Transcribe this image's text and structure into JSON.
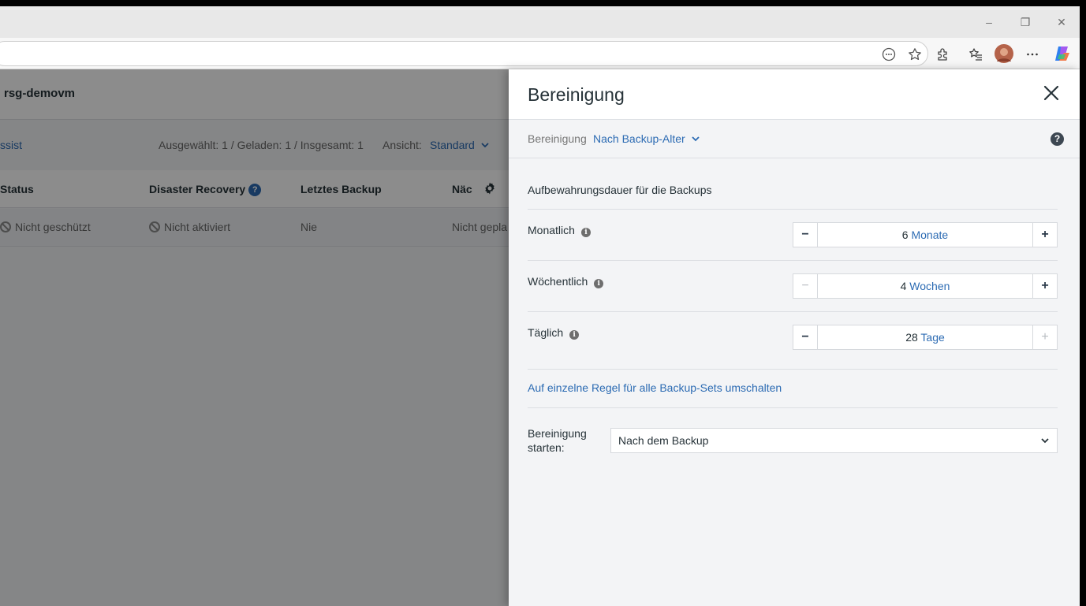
{
  "browser": {
    "controls": {
      "minimize": "–",
      "restore": "❐",
      "close": "✕"
    },
    "toolbar_icons": [
      "reader-icon",
      "favorite-star-icon",
      "extensions-icon",
      "favorites-icon",
      "profile-avatar",
      "more-icon",
      "copilot-icon"
    ]
  },
  "page": {
    "title": "rsg-demovm",
    "assist_link": "ssist",
    "selection_info": "Ausgewählt: 1 / Geladen: 1 / Insgesamt: 1",
    "view_label": "Ansicht:",
    "view_value": "Standard",
    "table": {
      "headers": [
        "Status",
        "Disaster Recovery",
        "Letztes Backup",
        "Näc"
      ],
      "row": {
        "status": "Nicht geschützt",
        "disaster_recovery": "Nicht aktiviert",
        "last_backup": "Nie",
        "next": "Nicht gepla"
      }
    }
  },
  "panel": {
    "title": "Bereinigung",
    "sub_label": "Bereinigung",
    "sub_value": "Nach Backup-Alter",
    "section_title": "Aufbewahrungsdauer für die Backups",
    "rules": [
      {
        "label": "Monatlich",
        "number": "6",
        "unit": "Monate",
        "minus_enabled": true,
        "plus_enabled": true
      },
      {
        "label": "Wöchentlich",
        "number": "4",
        "unit": "Wochen",
        "minus_enabled": false,
        "plus_enabled": true
      },
      {
        "label": "Täglich",
        "number": "28",
        "unit": "Tage",
        "minus_enabled": true,
        "plus_enabled": false
      }
    ],
    "minus_symbol": "−",
    "plus_symbol": "+",
    "switch_link": "Auf einzelne Regel für alle Backup-Sets umschalten",
    "start_label": "Bereinigung starten:",
    "start_value": "Nach dem Backup"
  }
}
